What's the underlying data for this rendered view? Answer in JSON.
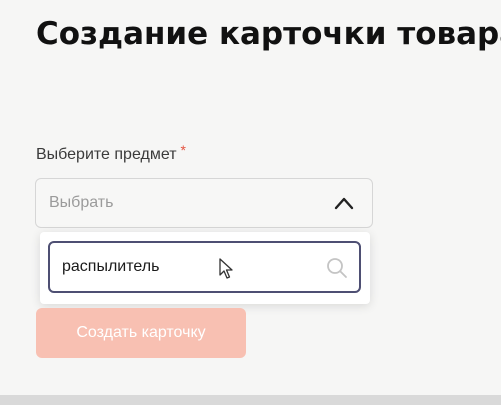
{
  "page": {
    "title": "Создание карточки товара"
  },
  "form": {
    "subject_label": "Выберите предмет",
    "required_mark": "*",
    "select_placeholder": "Выбрать",
    "search_value": "распылитель",
    "create_button_label": "Создать карточку"
  },
  "icons": {
    "chevron": "chevron-up-icon",
    "search": "search-icon",
    "cursor": "mouse-cursor-icon"
  },
  "colors": {
    "accent": "#f8c0b2",
    "required": "#e4523f",
    "input_border_active": "#4e4f73"
  }
}
